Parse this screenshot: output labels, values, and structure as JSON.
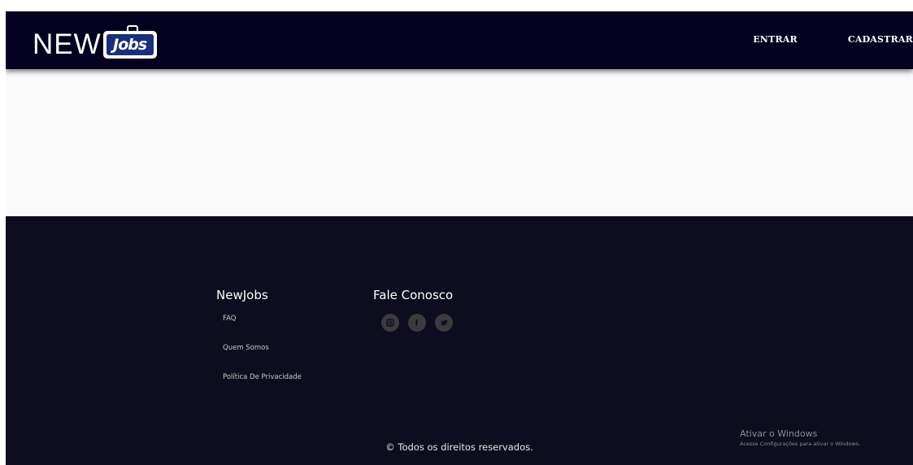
{
  "header": {
    "logo": {
      "new_text": "NEW",
      "jobs_text": "Jobs"
    },
    "nav": {
      "login_label": "ENTRAR",
      "signup_label": "CADASTRAR"
    }
  },
  "footer": {
    "brand_title": "NewJobs",
    "links": [
      "FAQ",
      "Quem Somos",
      "Política De Privacidade"
    ],
    "contact_title": "Fale Conosco",
    "social_icons": [
      "instagram-icon",
      "facebook-icon",
      "twitter-icon"
    ],
    "copyright": "© Todos os direitos reservados."
  },
  "watermark": {
    "title": "Ativar o Windows",
    "subtitle": "Acesse Configurações para ativar o Windows."
  },
  "colors": {
    "header_bg": "#03011f",
    "footer_bg": "#0d0d1f",
    "content_bg": "#fafafa"
  }
}
